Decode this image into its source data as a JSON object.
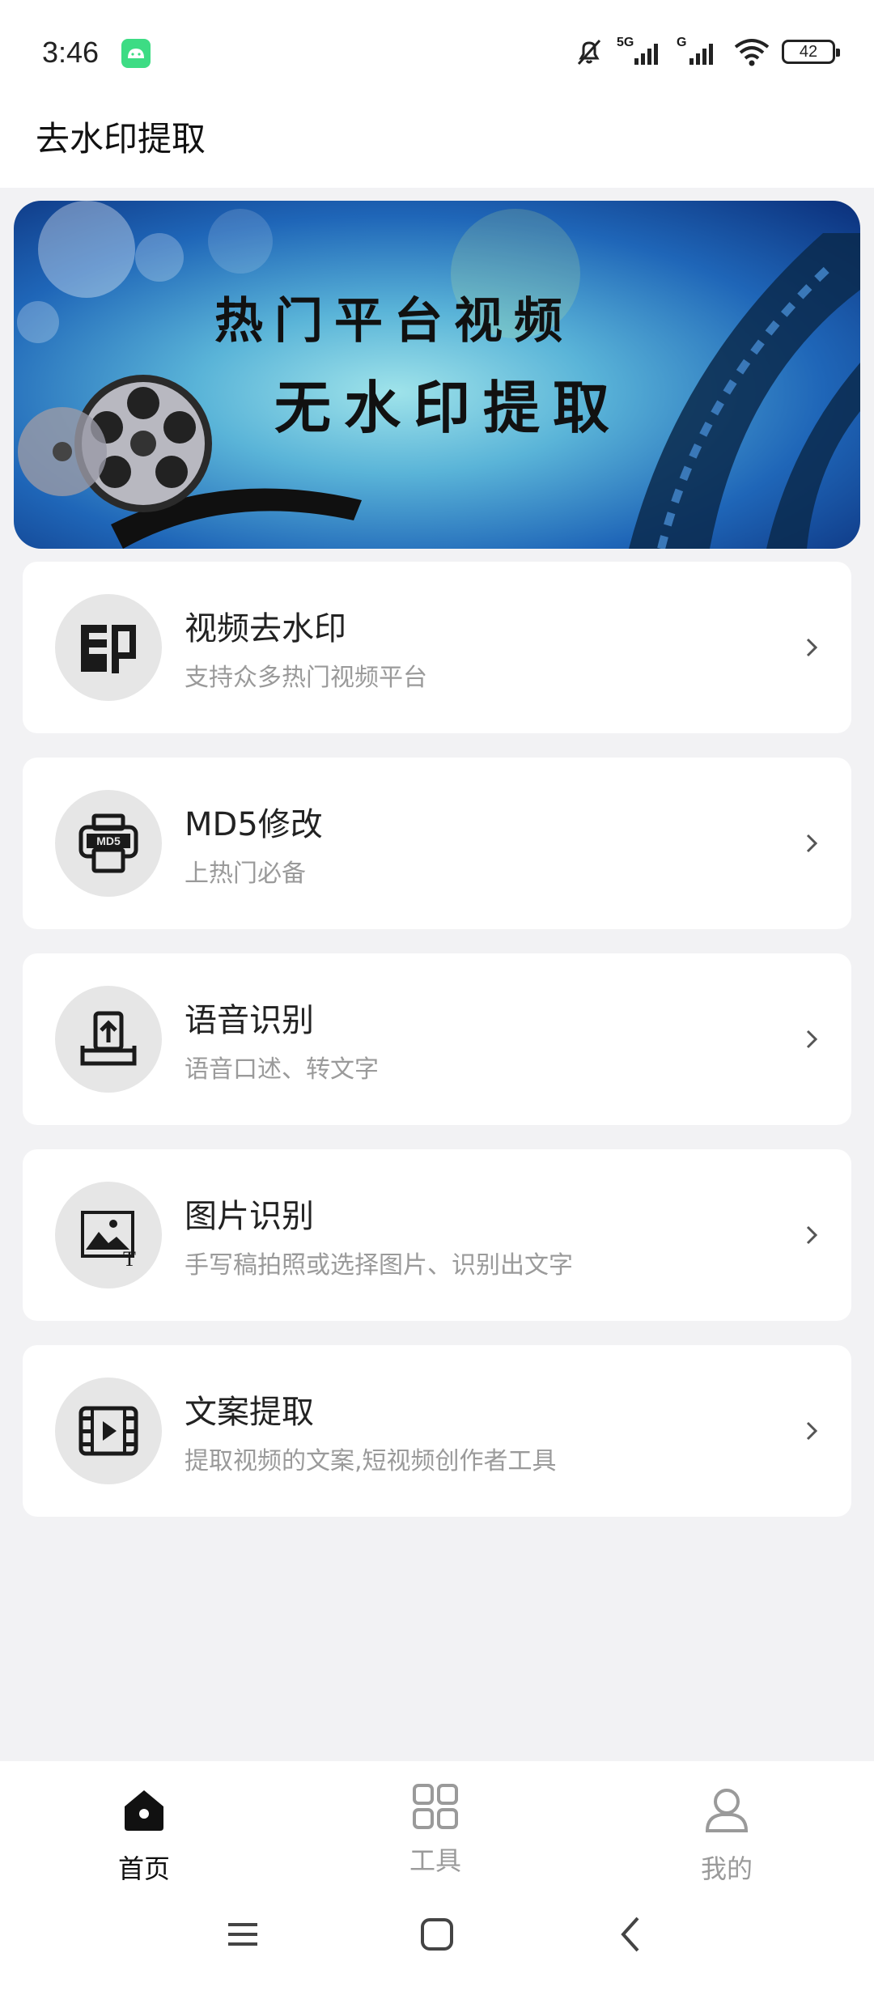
{
  "status_bar": {
    "time": "3:46",
    "network_labels": [
      "5G",
      "G"
    ],
    "battery_level": "42",
    "icons": [
      "android-app-icon",
      "mute-bell-icon",
      "signal-icon",
      "signal-icon",
      "wifi-icon",
      "battery-icon"
    ]
  },
  "app_bar": {
    "title": "去水印提取"
  },
  "banner": {
    "line1": "热门平台视频",
    "line2": "无水印提取"
  },
  "cards": [
    {
      "title": "视频去水印",
      "subtitle": "支持众多热门视频平台",
      "icon": "seal-stamp-icon"
    },
    {
      "title": "MD5修改",
      "subtitle": "上热门必备",
      "icon": "md5-printer-icon",
      "icon_text": "MD5"
    },
    {
      "title": "语音识别",
      "subtitle": "语音口述、转文字",
      "icon": "upload-tray-icon"
    },
    {
      "title": "图片识别",
      "subtitle": "手写稿拍照或选择图片、识别出文字",
      "icon": "image-text-icon",
      "icon_text": "T"
    },
    {
      "title": "文案提取",
      "subtitle": "提取视频的文案,短视频创作者工具",
      "icon": "video-film-icon"
    }
  ],
  "bottom_nav": {
    "items": [
      {
        "label": "首页",
        "icon": "home-icon",
        "active": true
      },
      {
        "label": "工具",
        "icon": "grid-icon",
        "active": false
      },
      {
        "label": "我的",
        "icon": "user-icon",
        "active": false
      }
    ]
  },
  "system_nav": [
    "menu-icon",
    "home-square-icon",
    "back-icon"
  ],
  "colors": {
    "background": "#f2f2f4",
    "card": "#ffffff",
    "icon_circle": "#e6e6e6",
    "subtitle": "#9a9a9a",
    "nav_active": "#111111",
    "nav_inactive": "#9a9a9a"
  }
}
